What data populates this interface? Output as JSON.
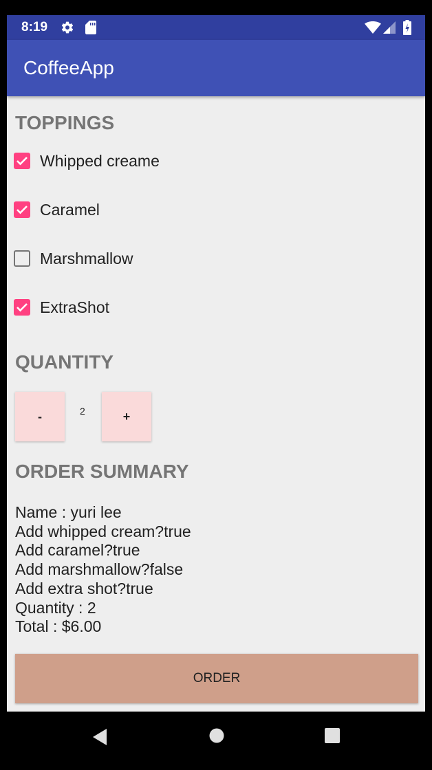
{
  "status_bar": {
    "time": "8:19",
    "icons": [
      "gear-icon",
      "sd-card-icon",
      "wifi-icon",
      "signal-icon",
      "battery-icon"
    ]
  },
  "app_bar": {
    "title": "CoffeeApp",
    "color": "#3f51b5"
  },
  "toppings": {
    "heading": "TOPPINGS",
    "items": [
      {
        "label": "Whipped creame",
        "checked": true
      },
      {
        "label": "Caramel",
        "checked": true
      },
      {
        "label": "Marshmallow",
        "checked": false
      },
      {
        "label": "ExtraShot",
        "checked": true
      }
    ]
  },
  "quantity": {
    "heading": "QUANTITY",
    "decrement_label": "-",
    "value": "2",
    "increment_label": "+"
  },
  "order_summary": {
    "heading": "ORDER SUMMARY",
    "lines": [
      "Name : yuri lee",
      "Add whipped cream?true",
      "Add caramel?true",
      "Add marshmallow?false",
      "Add extra shot?true",
      "Quantity : 2",
      "Total : $6.00"
    ]
  },
  "order_button": {
    "label": "ORDER",
    "color": "#cf9f8a"
  },
  "accent_color": "#ff4081",
  "nav_bar": {
    "icons": [
      "back-icon",
      "home-icon",
      "recents-icon"
    ]
  }
}
